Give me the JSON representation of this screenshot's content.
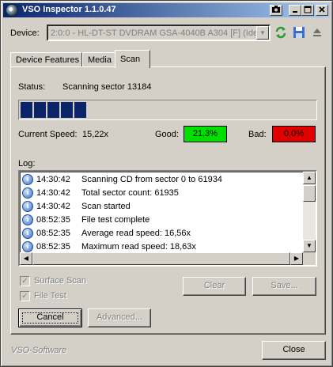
{
  "window": {
    "title": "VSO Inspector 1.1.0.47"
  },
  "titlebar": {
    "buttons": [
      "camera-icon",
      "minimize-icon",
      "maximize-icon",
      "close-icon"
    ]
  },
  "device": {
    "label": "Device:",
    "value": "2:0:0 - HL-DT-ST DVDRAM GSA-4040B A304 [F] (Ide)"
  },
  "tabs": [
    {
      "label": "Device Features"
    },
    {
      "label": "Media"
    },
    {
      "label": "Scan",
      "active": true
    }
  ],
  "scan": {
    "status_label": "Status:",
    "status_value": "Scanning sector 13184",
    "progress_blocks": 5,
    "speed_label": "Current Speed:",
    "speed_value": "15,22x",
    "good_label": "Good:",
    "good_value": "21,3%",
    "good_color": "#00e000",
    "bad_label": "Bad:",
    "bad_value": "0,0%",
    "bad_color": "#e00000"
  },
  "log": {
    "label": "Log:",
    "rows": [
      {
        "time": "14:30:42",
        "message": "Scanning CD from sector 0 to 61934"
      },
      {
        "time": "14:30:42",
        "message": "Total sector count: 61935"
      },
      {
        "time": "14:30:42",
        "message": "Scan started"
      },
      {
        "time": "08:52:35",
        "message": "File test complete"
      },
      {
        "time": "08:52:35",
        "message": "Average read speed: 16,56x"
      },
      {
        "time": "08:52:35",
        "message": "Maximum read speed: 18,63x"
      }
    ]
  },
  "options": {
    "surface_scan": "Surface Scan",
    "file_test": "File Test"
  },
  "buttons": {
    "clear": "Clear",
    "save": "Save...",
    "cancel": "Cancel",
    "advanced": "Advanced...",
    "close": "Close"
  },
  "footer": {
    "brand": "VSO-Software"
  }
}
